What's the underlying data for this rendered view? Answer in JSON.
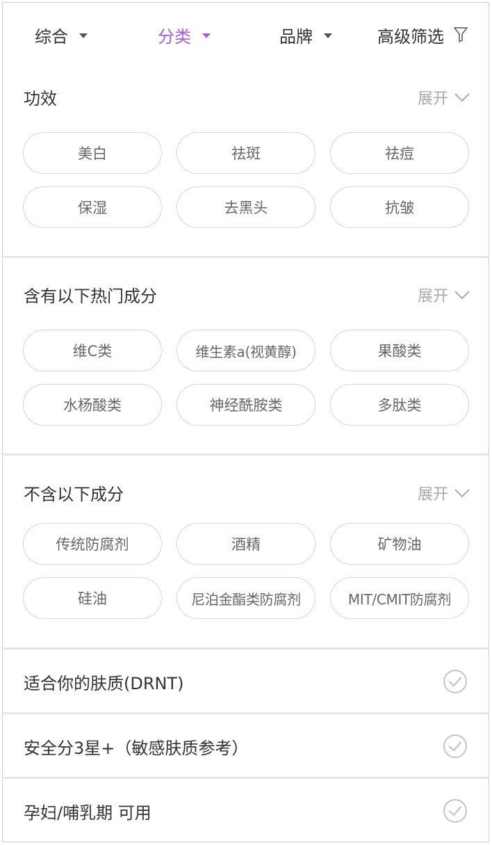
{
  "topbar": {
    "items": [
      {
        "label": "综合",
        "active": false
      },
      {
        "label": "分类",
        "active": true
      },
      {
        "label": "品牌",
        "active": false
      },
      {
        "label": "高级筛选",
        "icon": "filter-funnel-icon"
      }
    ],
    "accent_color": "#a35ee0"
  },
  "sections": [
    {
      "title": "功效",
      "expand_label": "展开",
      "chips": [
        "美白",
        "祛斑",
        "祛痘",
        "保湿",
        "去黑头",
        "抗皱"
      ]
    },
    {
      "title": "含有以下热门成分",
      "expand_label": "展开",
      "chips": [
        "维C类",
        "维生素a(视黄醇)",
        "果酸类",
        "水杨酸类",
        "神经酰胺类",
        "多肽类"
      ]
    },
    {
      "title": "不含以下成分",
      "expand_label": "展开",
      "chips": [
        "传统防腐剂",
        "酒精",
        "矿物油",
        "硅油",
        "尼泊金酯类防腐剂",
        "MIT/CMIT防腐剂"
      ]
    }
  ],
  "toggles": [
    {
      "label": "适合你的肤质(DRNT)",
      "checked": false,
      "icon": "check-circle-icon"
    },
    {
      "label": "安全分3星+（敏感肤质参考）",
      "checked": false,
      "icon": "check-circle-icon"
    },
    {
      "label": "孕妇/哺乳期 可用",
      "checked": false,
      "icon": "check-circle-icon"
    }
  ]
}
